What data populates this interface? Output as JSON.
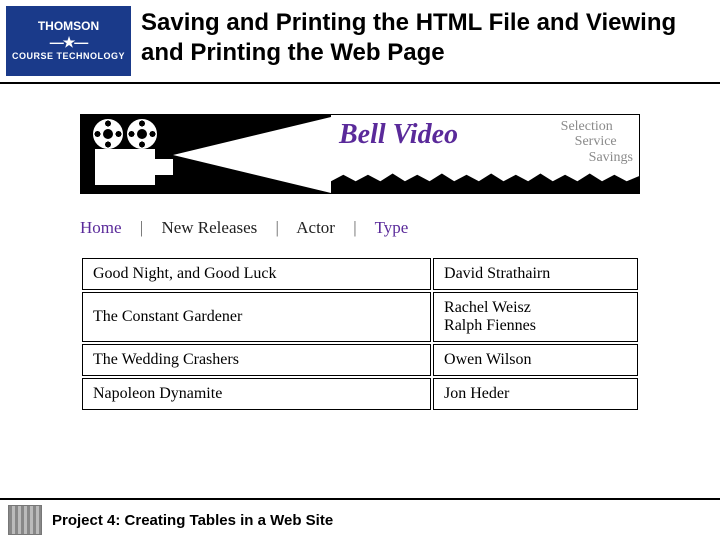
{
  "logo": {
    "line1": "THOMSON",
    "divider": "—★—",
    "line2": "COURSE TECHNOLOGY"
  },
  "title": "Saving and Printing the HTML File and Viewing and Printing the Web Page",
  "banner": {
    "brand": "Bell Video",
    "tags": [
      "Selection",
      "Service",
      "Savings"
    ]
  },
  "nav": {
    "items": [
      "Home",
      "New Releases",
      "Actor",
      "Type"
    ],
    "separator": "|"
  },
  "movies": [
    {
      "title": "Good Night, and Good Luck",
      "actor": "David Strathairn"
    },
    {
      "title": "The Constant Gardener",
      "actor": "Rachel Weisz\nRalph Fiennes"
    },
    {
      "title": "The Wedding Crashers",
      "actor": "Owen Wilson"
    },
    {
      "title": "Napoleon Dynamite",
      "actor": "Jon Heder"
    }
  ],
  "footer": "Project 4: Creating Tables in a Web Site"
}
